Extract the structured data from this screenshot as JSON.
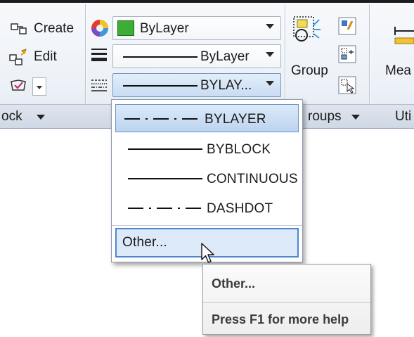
{
  "ribbon": {
    "create_label": "Create",
    "edit_label": "Edit",
    "block_panel_title": "ock",
    "group_label": "Group",
    "groups_panel_title": "roups",
    "measure_label": "Mea",
    "utilities_panel_title": "Uti"
  },
  "properties": {
    "color_value": "ByLayer",
    "lineweight_value": "ByLayer",
    "linetype_value": "BYLAY...",
    "color_swatch": "#3cae35"
  },
  "linetype_dropdown": {
    "items": [
      {
        "label": "BYLAYER",
        "pattern": "dashdot",
        "selected": true
      },
      {
        "label": "BYBLOCK",
        "pattern": "solid",
        "selected": false
      },
      {
        "label": "CONTINUOUS",
        "pattern": "solid",
        "selected": false
      },
      {
        "label": "DASHDOT",
        "pattern": "dashdot",
        "selected": false
      }
    ],
    "other_label": "Other..."
  },
  "tooltip": {
    "title": "Other...",
    "help_text": "Press F1 for more help"
  },
  "colors": {
    "highlight_border": "#4f87cf",
    "highlight_fill": "#dbe9f8"
  }
}
